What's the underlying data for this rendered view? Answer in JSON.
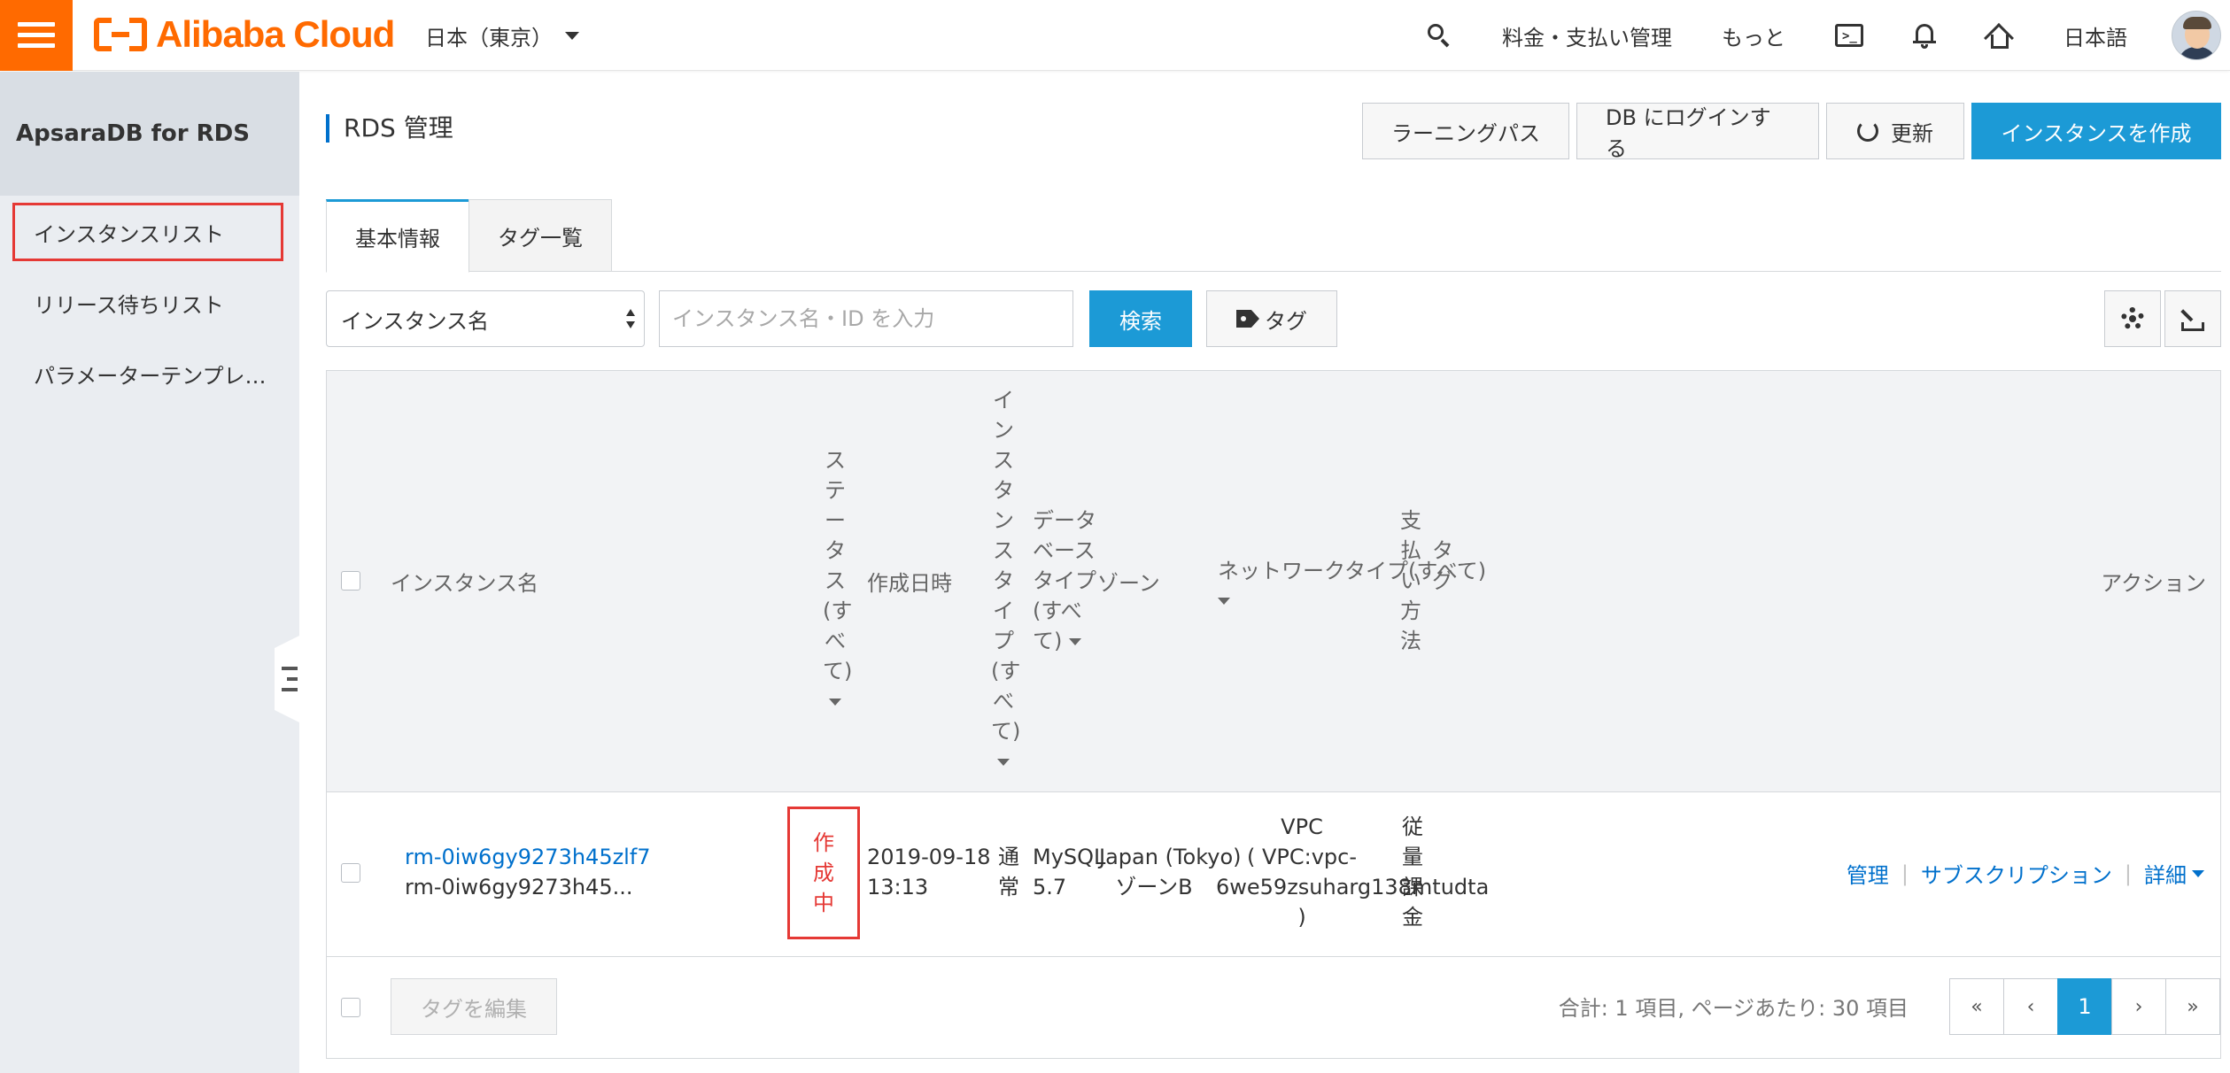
{
  "topbar": {
    "logo_text": "Alibaba Cloud",
    "region": "日本（東京）",
    "billing": "料金・支払い管理",
    "more": "もっと",
    "language": "日本語"
  },
  "sidebar": {
    "title": "ApsaraDB for RDS",
    "items": [
      {
        "label": "インスタンスリスト"
      },
      {
        "label": "リリース待ちリスト"
      },
      {
        "label": "パラメーターテンプレ…"
      }
    ]
  },
  "page": {
    "title": "RDS 管理",
    "buttons": {
      "learning": "ラーニングパス",
      "db_login": "DB にログインする",
      "refresh": "更新",
      "create": "インスタンスを作成"
    },
    "tabs": [
      {
        "label": "基本情報"
      },
      {
        "label": "タグ一覧"
      }
    ]
  },
  "filter": {
    "select_value": "インスタンス名",
    "input_placeholder": "インスタンス名・ID を入力",
    "search": "検索",
    "tag": "タグ"
  },
  "table": {
    "headers": {
      "name": "インスタンス名",
      "status_chars": [
        "ス",
        "テ",
        "ー",
        "タ",
        "ス",
        "(す",
        "べ",
        "て)"
      ],
      "created": "作成日時",
      "instance_type_chars": [
        "イ",
        "ン",
        "ス",
        "タ",
        "ン",
        "ス",
        "タ",
        "イ",
        "プ",
        "(す",
        "べ",
        "て)"
      ],
      "db_type_lines": [
        "データ",
        "ベース",
        "タイプ",
        "(すべ",
        "て)"
      ],
      "zone": "ゾーン",
      "network": "ネットワークタイプ(すべて)",
      "payment_chars": [
        "支",
        "払",
        "い",
        "方",
        "法"
      ],
      "tag_chars": [
        "タ",
        "グ"
      ],
      "action": "アクション"
    },
    "rows": [
      {
        "id": "rm-0iw6gy9273h45zlf7",
        "name": "rm-0iw6gy9273h45...",
        "status_chars": [
          "作",
          "成",
          "中"
        ],
        "created_date": "2019-09-18",
        "created_time": "13:13",
        "instance_type_chars": [
          "通",
          "常"
        ],
        "db_type_lines": [
          "MySQL",
          "5.7"
        ],
        "zone_lines": [
          "Japan (Tokyo)",
          "ゾーンB"
        ],
        "network_lines": [
          "VPC",
          "( VPC:vpc-",
          "6we59zsuharg138mtudta",
          ")"
        ],
        "payment_chars": [
          "従",
          "量",
          "課",
          "金"
        ],
        "actions": {
          "manage": "管理",
          "subscription": "サブスクリプション",
          "detail": "詳細"
        }
      }
    ]
  },
  "footer": {
    "edit_tags": "タグを編集",
    "summary": "合計: 1 項目, ページあたり: 30 項目",
    "pager": {
      "first": "«",
      "prev": "‹",
      "current": "1",
      "next": "›",
      "last": "»"
    }
  }
}
